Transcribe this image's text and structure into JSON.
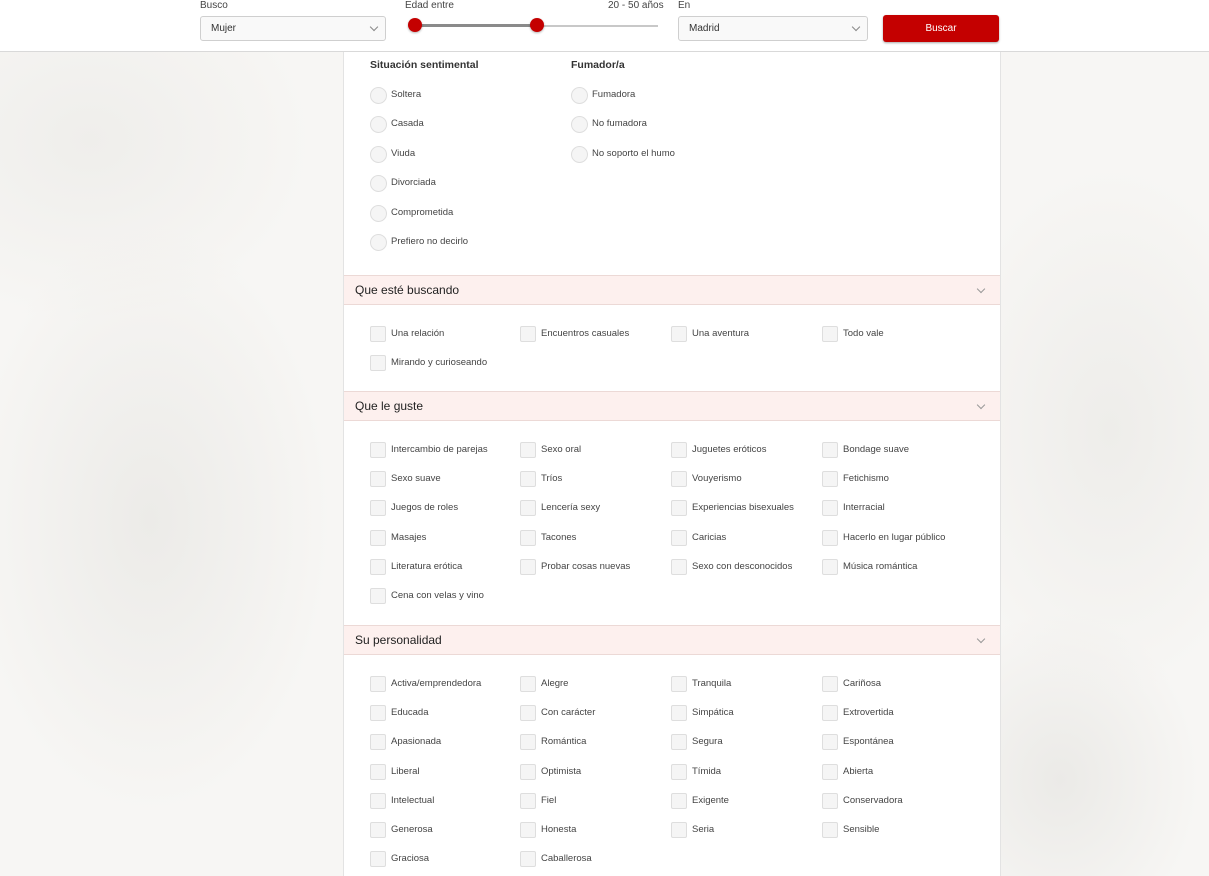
{
  "search_bar": {
    "looking_for_label": "Busco",
    "looking_for_value": "Mujer",
    "age_label": "Edad entre",
    "age_range_text": "20 - 50 años",
    "age_slider": {
      "min_fraction": 0.0,
      "low_fraction": 0.0,
      "high_fraction": 0.5
    },
    "location_label": "En",
    "location_value": "Madrid",
    "search_button": "Buscar",
    "accent_color": "#c40000"
  },
  "relationship_status": {
    "title": "Situación sentimental",
    "options": [
      "Soltera",
      "Casada",
      "Viuda",
      "Divorciada",
      "Comprometida",
      "Prefiero no decirlo"
    ]
  },
  "smoker": {
    "title": "Fumador/a",
    "options": [
      "Fumadora",
      "No fumadora",
      "No soporto el humo"
    ]
  },
  "sections": [
    {
      "title": "Que esté buscando",
      "options": [
        "Una relación",
        "Encuentros casuales",
        "Una aventura",
        "Todo vale",
        "Mirando y curioseando"
      ]
    },
    {
      "title": "Que le guste",
      "options": [
        "Intercambio de parejas",
        "Sexo oral",
        "Juguetes eróticos",
        "Bondage suave",
        "Sexo suave",
        "Tríos",
        "Vouyerismo",
        "Fetichismo",
        "Juegos de roles",
        "Lencería sexy",
        "Experiencias bisexuales",
        "Interracial",
        "Masajes",
        "Tacones",
        "Caricias",
        "Hacerlo en lugar público",
        "Literatura erótica",
        "Probar cosas nuevas",
        "Sexo con desconocidos",
        "Música romántica",
        "Cena con velas y vino"
      ]
    },
    {
      "title": "Su personalidad",
      "options": [
        "Activa/emprendedora",
        "Alegre",
        "Tranquila",
        "Cariñosa",
        "Educada",
        "Con carácter",
        "Simpática",
        "Extrovertida",
        "Apasionada",
        "Romántica",
        "Segura",
        "Espontánea",
        "Liberal",
        "Optimista",
        "Tímida",
        "Abierta",
        "Intelectual",
        "Fiel",
        "Exigente",
        "Conservadora",
        "Generosa",
        "Honesta",
        "Seria",
        "Sensible",
        "Graciosa",
        "Caballerosa"
      ]
    }
  ]
}
